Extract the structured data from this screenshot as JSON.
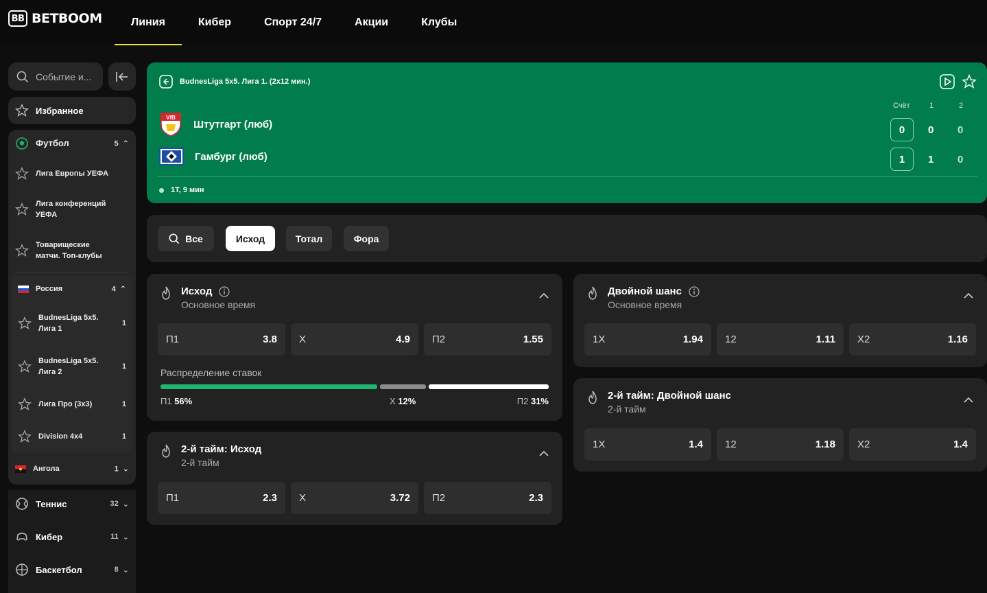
{
  "brand": {
    "logo_mark": "BB",
    "name": "BETBOOM"
  },
  "nav": [
    {
      "label": "Линия",
      "active": true
    },
    {
      "label": "Кибер"
    },
    {
      "label": "Спорт 24/7"
    },
    {
      "label": "Акции"
    },
    {
      "label": "Клубы"
    }
  ],
  "sidebar": {
    "search_placeholder": "Событие и...",
    "favorites": "Избранное",
    "football": {
      "label": "Футбол",
      "count": "5"
    },
    "football_items": [
      {
        "label": "Лига Европы УЕФА"
      },
      {
        "label": "Лига конференций УЕФА"
      },
      {
        "label": "Товарищеские матчи. Топ-клубы"
      }
    ],
    "russia": {
      "label": "Россия",
      "count": "4"
    },
    "russia_items": [
      {
        "label": "BudnesLiga 5x5. Лига 1",
        "count": "1"
      },
      {
        "label": "BudnesLiga 5x5. Лига 2",
        "count": "1"
      },
      {
        "label": "Лига Про (3х3)",
        "count": "1"
      },
      {
        "label": "Division 4x4",
        "count": "1"
      }
    ],
    "angola": {
      "label": "Ангола",
      "count": "1"
    },
    "sports": [
      {
        "label": "Теннис",
        "count": "32",
        "icon": "tennis-icon"
      },
      {
        "label": "Кибер",
        "count": "11",
        "icon": "gamepad-icon"
      },
      {
        "label": "Баскетбол",
        "count": "8",
        "icon": "basketball-icon"
      }
    ]
  },
  "match": {
    "league": "BudnesLiga 5x5. Лига 1. (2х12 мин.)",
    "header_score": "Счёт",
    "header_p1": "1",
    "header_p2": "2",
    "team1": {
      "name": "Штутгарт (люб)",
      "score": "0",
      "p1": "0",
      "p2": "0"
    },
    "team2": {
      "name": "Гамбург (люб)",
      "score": "1",
      "p1": "1",
      "p2": "0"
    },
    "status": "1Т, 9 мин"
  },
  "filters": [
    {
      "label": "Все",
      "icon": "search-icon"
    },
    {
      "label": "Исход",
      "active": true
    },
    {
      "label": "Тотал"
    },
    {
      "label": "Фора"
    }
  ],
  "markets": {
    "outcome": {
      "title": "Исход",
      "subtitle": "Основное время",
      "odds": [
        {
          "name": "П1",
          "value": "3.8"
        },
        {
          "name": "X",
          "value": "4.9"
        },
        {
          "name": "П2",
          "value": "1.55"
        }
      ],
      "distribution_label": "Распределение ставок",
      "distribution": [
        {
          "name": "П1",
          "pct": "56%",
          "share": 56,
          "color": "#1db56f"
        },
        {
          "name": "X",
          "pct": "12%",
          "share": 12,
          "color": "#8c8c8c"
        },
        {
          "name": "П2",
          "pct": "31%",
          "share": 31,
          "color": "#ffffff"
        }
      ]
    },
    "half2_outcome": {
      "title": "2-й тайм: Исход",
      "subtitle": "2-й тайм",
      "odds": [
        {
          "name": "П1",
          "value": "2.3"
        },
        {
          "name": "X",
          "value": "3.72"
        },
        {
          "name": "П2",
          "value": "2.3"
        }
      ]
    },
    "double_chance": {
      "title": "Двойной шанс",
      "subtitle": "Основное время",
      "odds": [
        {
          "name": "1X",
          "value": "1.94"
        },
        {
          "name": "12",
          "value": "1.11"
        },
        {
          "name": "X2",
          "value": "1.16"
        }
      ]
    },
    "half2_double": {
      "title": "2-й тайм: Двойной шанс",
      "subtitle": "2-й тайм",
      "odds": [
        {
          "name": "1X",
          "value": "1.4"
        },
        {
          "name": "12",
          "value": "1.18"
        },
        {
          "name": "X2",
          "value": "1.4"
        }
      ]
    }
  }
}
